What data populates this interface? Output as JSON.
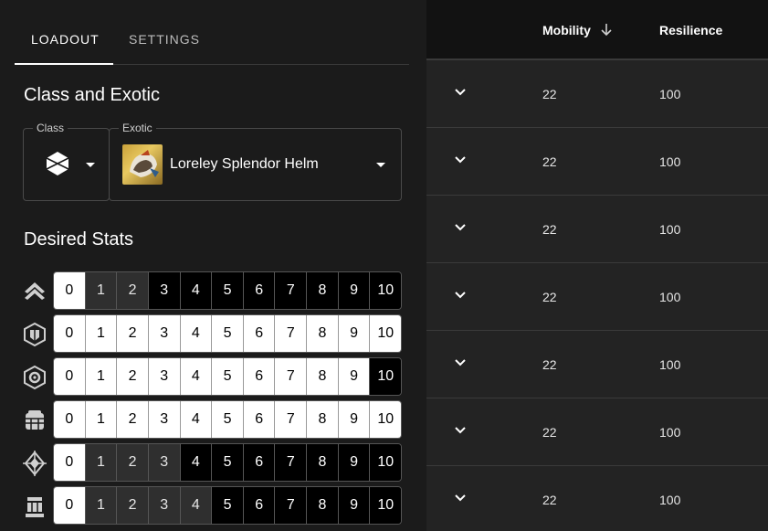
{
  "tabs": [
    {
      "label": "LOADOUT",
      "active": true
    },
    {
      "label": "SETTINGS",
      "active": false
    }
  ],
  "class_exotic": {
    "title": "Class and Exotic",
    "class_legend": "Class",
    "class_icon": "hunter-class-icon",
    "exotic_legend": "Exotic",
    "exotic_name": "Loreley Splendor Helm"
  },
  "desired_stats": {
    "title": "Desired Stats",
    "levels": [
      "0",
      "1",
      "2",
      "3",
      "4",
      "5",
      "6",
      "7",
      "8",
      "9",
      "10"
    ],
    "stats": [
      {
        "icon": "mobility-icon",
        "selected": 3
      },
      {
        "icon": "resilience-icon",
        "selected": 0
      },
      {
        "icon": "recovery-icon",
        "selected": 10
      },
      {
        "icon": "discipline-icon",
        "selected": 0
      },
      {
        "icon": "intellect-icon",
        "selected": 4
      },
      {
        "icon": "strength-icon",
        "selected": 5
      }
    ]
  },
  "results": {
    "columns": [
      {
        "label": "Mobility",
        "sort": "descending"
      },
      {
        "label": "Resilience"
      }
    ],
    "rows": [
      {
        "mobility": "22",
        "resilience": "100"
      },
      {
        "mobility": "22",
        "resilience": "100"
      },
      {
        "mobility": "22",
        "resilience": "100"
      },
      {
        "mobility": "22",
        "resilience": "100"
      },
      {
        "mobility": "22",
        "resilience": "100"
      },
      {
        "mobility": "22",
        "resilience": "100"
      },
      {
        "mobility": "22",
        "resilience": "100"
      }
    ]
  }
}
